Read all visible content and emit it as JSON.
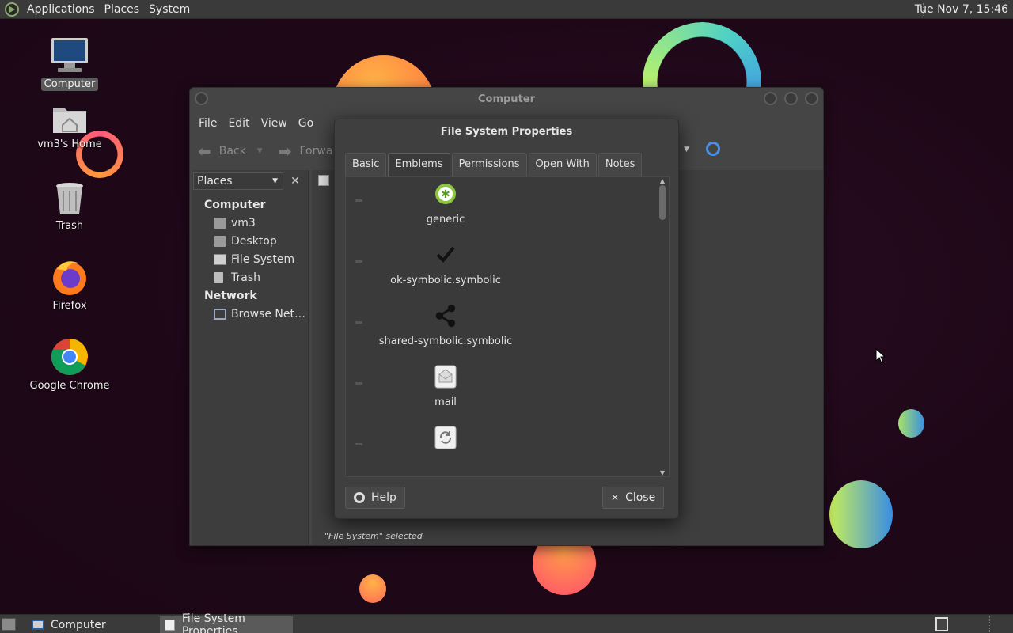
{
  "top_panel": {
    "menus": [
      "Applications",
      "Places",
      "System"
    ],
    "clock": "Tue Nov 7, 15:46"
  },
  "desktop_icons": [
    {
      "label": "Computer",
      "icon": "computer-icon",
      "selected": true
    },
    {
      "label": "vm3's Home",
      "icon": "home-folder-icon"
    },
    {
      "label": "Trash",
      "icon": "trash-icon"
    },
    {
      "label": "Firefox",
      "icon": "firefox-icon"
    },
    {
      "label": "Google Chrome",
      "icon": "chrome-icon"
    }
  ],
  "computer_window": {
    "title": "Computer",
    "menu": [
      "File",
      "Edit",
      "View",
      "Go"
    ],
    "toolbar": {
      "back": "Back",
      "forward": "Forwa"
    },
    "sidebar": {
      "selector": "Places",
      "computer_heading": "Computer",
      "computer_items": [
        "vm3",
        "Desktop",
        "File System",
        "Trash"
      ],
      "network_heading": "Network",
      "network_items": [
        "Browse Net…"
      ]
    },
    "status": "\"File System\" selected"
  },
  "dialog": {
    "title": "File System Properties",
    "tabs": [
      "Basic",
      "Emblems",
      "Permissions",
      "Open With",
      "Notes"
    ],
    "active_tab": "Emblems",
    "emblems": [
      {
        "label": "generic",
        "icon": "generic-emblem-icon"
      },
      {
        "label": "ok-symbolic.symbolic",
        "icon": "checkmark-icon"
      },
      {
        "label": "shared-symbolic.symbolic",
        "icon": "share-icon"
      },
      {
        "label": "mail",
        "icon": "mail-icon"
      },
      {
        "label": "",
        "icon": "sync-icon"
      }
    ],
    "help_label": "Help",
    "close_label": "Close"
  },
  "taskbar": {
    "tasks": [
      "Computer",
      "File System Properties"
    ],
    "active_task": "File System Properties"
  }
}
